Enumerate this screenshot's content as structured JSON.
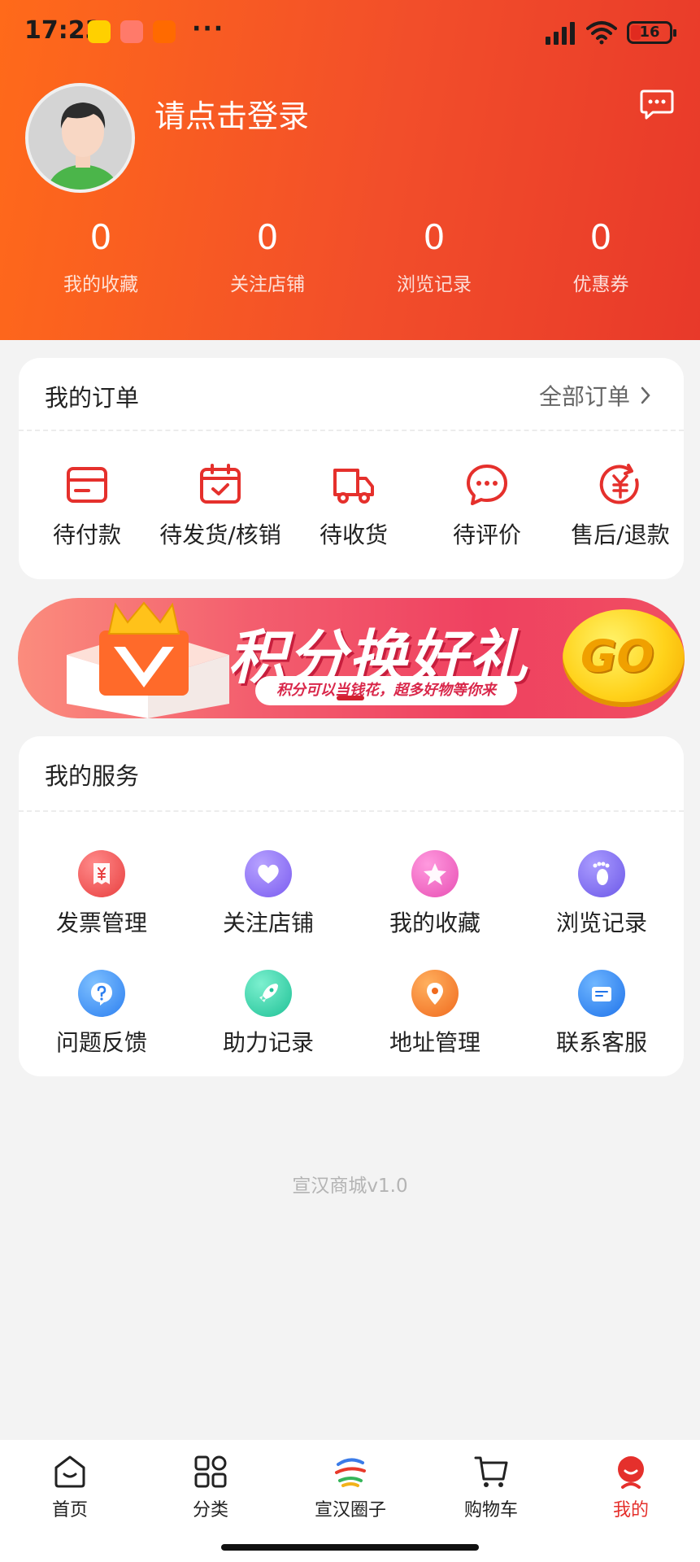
{
  "status_bar": {
    "time": "17:23",
    "dots": "···",
    "app_icons": [
      {
        "name": "meituan-app-icon",
        "color": "#ffd000"
      },
      {
        "name": "store-app-icon",
        "color": "#ff6b5a"
      },
      {
        "name": "mi-app-icon",
        "color": "#ff6a00"
      }
    ],
    "battery": "16"
  },
  "header": {
    "login_prompt": "请点击登录",
    "stats": [
      {
        "value": "0",
        "label": "我的收藏"
      },
      {
        "value": "0",
        "label": "关注店铺"
      },
      {
        "value": "0",
        "label": "浏览记录"
      },
      {
        "value": "0",
        "label": "优惠券"
      }
    ],
    "gradient_colors": [
      "#ff6a1a",
      "#e8392a"
    ]
  },
  "orders": {
    "title": "我的订单",
    "all_orders": "全部订单",
    "items": [
      {
        "label": "待付款",
        "icon": "wallet-icon"
      },
      {
        "label": "待发货/核销",
        "icon": "calendar-check-icon"
      },
      {
        "label": "待收货",
        "icon": "truck-icon"
      },
      {
        "label": "待评价",
        "icon": "comment-icon"
      },
      {
        "label": "售后/退款",
        "icon": "refund-icon"
      }
    ],
    "accent_color": "#e5302c"
  },
  "banner": {
    "title": "积分换好礼",
    "subtitle": "积分可以当钱花，超多好物等你来",
    "go": "GO"
  },
  "services": {
    "title": "我的服务",
    "items": [
      {
        "label": "发票管理",
        "icon": "invoice-icon",
        "color": "#f05454"
      },
      {
        "label": "关注店铺",
        "icon": "heart-icon",
        "color": "#8d6ff2"
      },
      {
        "label": "我的收藏",
        "icon": "star-icon",
        "color": "#f062c0"
      },
      {
        "label": "浏览记录",
        "icon": "footprint-icon",
        "color": "#7f6ef0"
      },
      {
        "label": "问题反馈",
        "icon": "question-icon",
        "color": "#3f8ff2"
      },
      {
        "label": "助力记录",
        "icon": "rocket-icon",
        "color": "#2fd0a8"
      },
      {
        "label": "地址管理",
        "icon": "location-icon",
        "color": "#f57a2c"
      },
      {
        "label": "联系客服",
        "icon": "chat-icon",
        "color": "#2f86f0"
      }
    ]
  },
  "footer": {
    "version": "宣汉商城v1.0"
  },
  "tabbar": {
    "items": [
      {
        "label": "首页",
        "icon": "home-icon",
        "active": false
      },
      {
        "label": "分类",
        "icon": "grid-icon",
        "active": false
      },
      {
        "label": "宣汉圈子",
        "icon": "circle-logo-icon",
        "active": false
      },
      {
        "label": "购物车",
        "icon": "cart-icon",
        "active": false
      },
      {
        "label": "我的",
        "icon": "profile-icon",
        "active": true
      }
    ],
    "active_color": "#e5302c"
  }
}
